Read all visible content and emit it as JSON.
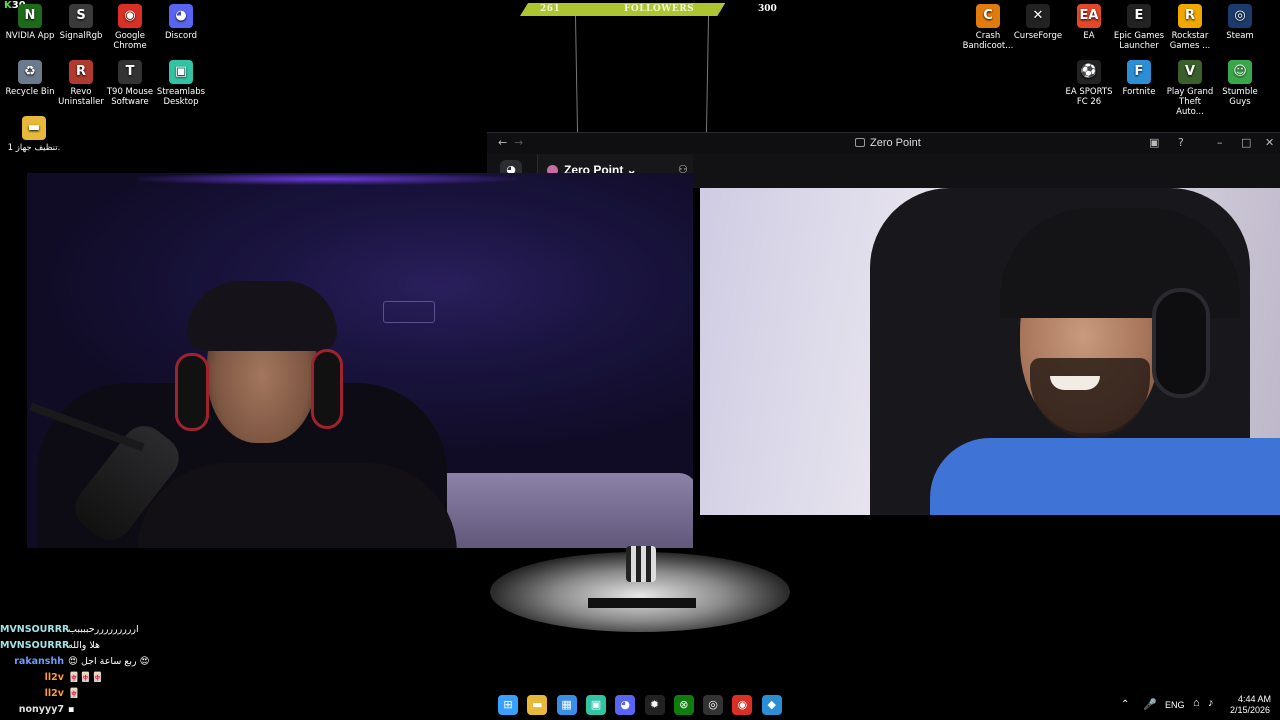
{
  "desktop": {
    "fps_counter": "30",
    "icons_left": [
      {
        "name": "nvidia",
        "label": "NVIDIA App",
        "glyph": "N",
        "color": "#1d6b1a"
      },
      {
        "name": "signalrgb",
        "label": "SignalRgb",
        "glyph": "S",
        "color": "#3a3a3a"
      },
      {
        "name": "chrome",
        "label": "Google Chrome",
        "glyph": "◉",
        "color": "#d93025"
      },
      {
        "name": "discord",
        "label": "Discord",
        "glyph": "◕",
        "color": "#5865f2"
      },
      {
        "name": "recycle-bin",
        "label": "Recycle Bin",
        "glyph": "♻",
        "color": "#6b7b8c"
      },
      {
        "name": "revo",
        "label": "Revo Uninstaller",
        "glyph": "R",
        "color": "#b03a2e"
      },
      {
        "name": "t90",
        "label": "T90 Mouse Software",
        "glyph": "T",
        "color": "#333"
      },
      {
        "name": "streamlabs",
        "label": "Streamlabs Desktop",
        "glyph": "▣",
        "color": "#31c3a2"
      },
      {
        "name": "folder",
        "label": "تنظيف جهاز 1.",
        "glyph": "▬",
        "color": "#e6b93a"
      }
    ],
    "icons_right": [
      {
        "name": "crash",
        "label": "Crash Bandicoot...",
        "glyph": "C",
        "color": "#e07b10"
      },
      {
        "name": "curseforge",
        "label": "CurseForge",
        "glyph": "✕",
        "color": "#222"
      },
      {
        "name": "ea",
        "label": "EA",
        "glyph": "EA",
        "color": "#e2482a"
      },
      {
        "name": "epic",
        "label": "Epic Games Launcher",
        "glyph": "E",
        "color": "#222"
      },
      {
        "name": "rockstar",
        "label": "Rockstar Games ...",
        "glyph": "R",
        "color": "#f0a800"
      },
      {
        "name": "steam",
        "label": "Steam",
        "glyph": "◎",
        "color": "#1b3c6b"
      },
      {
        "name": "easports",
        "label": "EA SPORTS FC 26",
        "glyph": "⚽",
        "color": "#222"
      },
      {
        "name": "fortnite",
        "label": "Fortnite",
        "glyph": "F",
        "color": "#2c8fd6"
      },
      {
        "name": "gta",
        "label": "Play Grand Theft Auto...",
        "glyph": "V",
        "color": "#3b5f2b"
      },
      {
        "name": "stumble",
        "label": "Stumble Guys",
        "glyph": "☺",
        "color": "#3aa84a"
      }
    ]
  },
  "follower_goal": {
    "current": "261",
    "label": "FOLLOWERS",
    "target": "300",
    "progress": 0.87
  },
  "discord": {
    "title": "Zero Point",
    "server_name": "Zero Point ⌄",
    "back": "←",
    "forward": "→"
  },
  "chat": [
    {
      "user": "MVNSOURRR",
      "color": "#9ee6e6",
      "msg": "ارررررررررحببببب"
    },
    {
      "user": "MVNSOURRR",
      "color": "#9ee6e6",
      "msg": "هلا والله"
    },
    {
      "user": "rakanshh",
      "color": "#6b9cff",
      "msg": "😍 ربع ساعة اجل 😍"
    },
    {
      "user": "ll2v",
      "color": "#ff9a2e",
      "msg": "🀄🀄🀄"
    },
    {
      "user": "ll2v",
      "color": "#ff9a2e",
      "msg": "🀄"
    },
    {
      "user": "nonyyy7",
      "color": "#e0e0e0",
      "msg": "▪"
    }
  ],
  "taskbar": {
    "apps": [
      {
        "name": "start",
        "glyph": "⊞",
        "color": "#3aa0ff"
      },
      {
        "name": "explorer",
        "glyph": "▬",
        "color": "#e6b93a"
      },
      {
        "name": "store",
        "glyph": "▦",
        "color": "#3a8ee6"
      },
      {
        "name": "streamlabs",
        "glyph": "▣",
        "color": "#31c3a2"
      },
      {
        "name": "discord",
        "glyph": "◕",
        "color": "#5865f2"
      },
      {
        "name": "steelseries",
        "glyph": "✹",
        "color": "#222"
      },
      {
        "name": "xbox",
        "glyph": "⊗",
        "color": "#107c10"
      },
      {
        "name": "obs",
        "glyph": "◎",
        "color": "#333"
      },
      {
        "name": "chrome",
        "glyph": "◉",
        "color": "#d93025"
      },
      {
        "name": "app",
        "glyph": "◆",
        "color": "#2c8fd6"
      }
    ],
    "lang": "ENG",
    "time": "4:44 AM",
    "date": "2/15/2026"
  }
}
